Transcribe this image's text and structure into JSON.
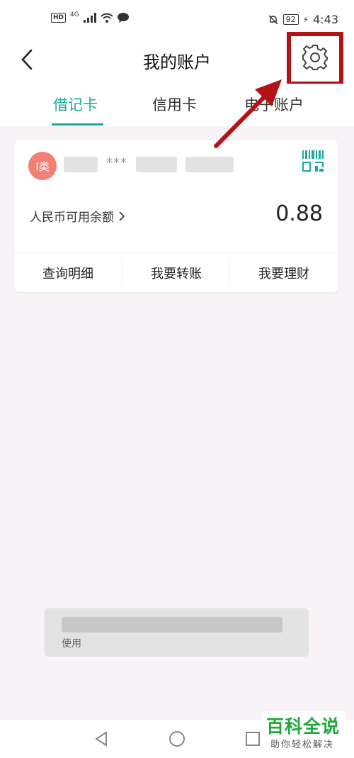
{
  "status_bar": {
    "hd": "HD",
    "network": "4G",
    "battery": "92",
    "time": "4:43"
  },
  "header": {
    "title": "我的账户",
    "back_icon": "chevron-left-icon",
    "settings_icon": "gear-icon"
  },
  "tabs": [
    {
      "label": "借记卡",
      "active": true
    },
    {
      "label": "信用卡",
      "active": false
    },
    {
      "label": "电子账户",
      "active": false
    }
  ],
  "card": {
    "class_badge": "I类",
    "account_number": "***",
    "balance_label": "人民币可用余额",
    "balance_value": "0.88",
    "actions": [
      "查询明细",
      "我要转账",
      "我要理财"
    ]
  },
  "toast": {
    "text": "使用"
  },
  "watermark": {
    "title": "百科全说",
    "subtitle": "助你轻松解决"
  },
  "colors": {
    "accent": "#1aa99a",
    "badge": "#f47f74",
    "highlight": "#b31217",
    "watermark": "#1fa83a"
  }
}
